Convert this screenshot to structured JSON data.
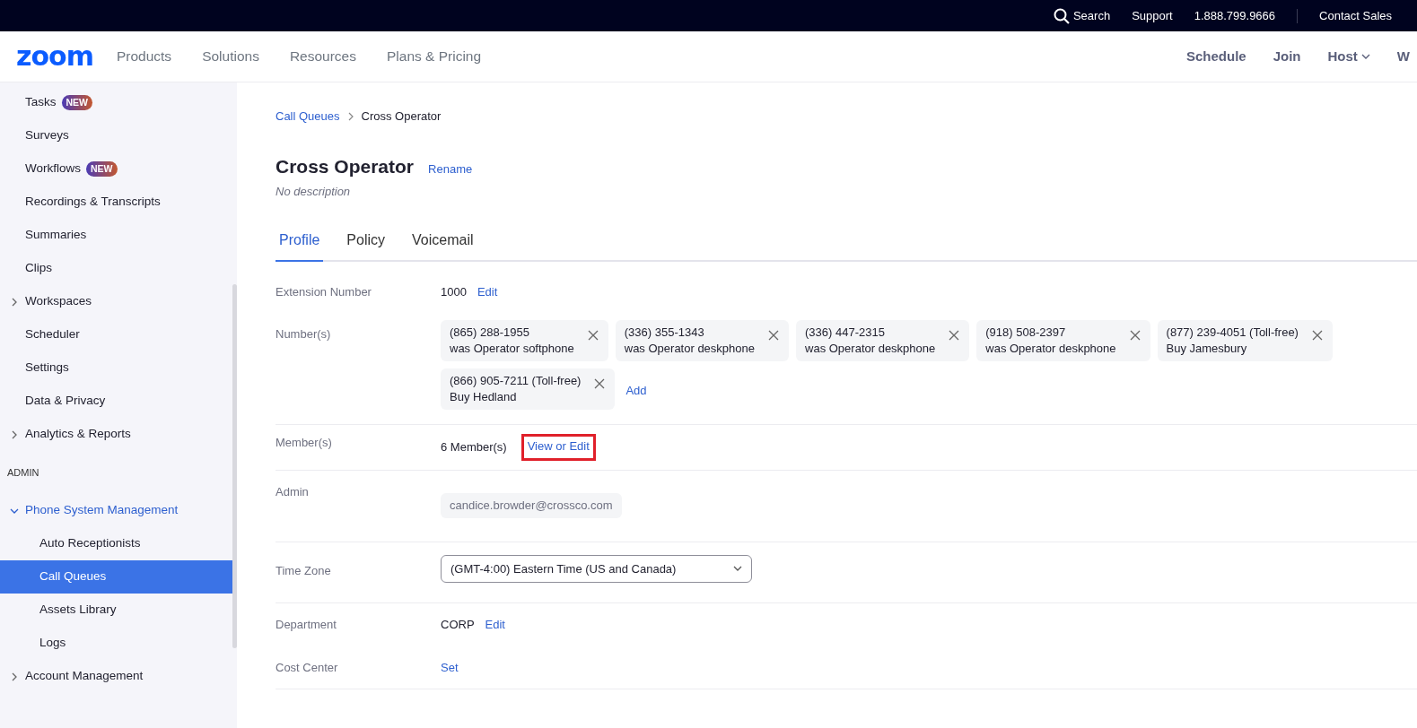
{
  "top_bar": {
    "search": "Search",
    "links": [
      "Support",
      "1.888.799.9666",
      "Contact Sales"
    ]
  },
  "nav": {
    "logo": "zoom",
    "menu": [
      "Products",
      "Solutions",
      "Resources",
      "Plans & Pricing"
    ],
    "actions": [
      {
        "label": "Schedule",
        "dropdown": false
      },
      {
        "label": "Join",
        "dropdown": false
      },
      {
        "label": "Host",
        "dropdown": true
      },
      {
        "label": "W",
        "dropdown": false
      }
    ]
  },
  "sidebar": {
    "items": [
      {
        "kind": "item",
        "label": "Tasks",
        "badge": "NEW"
      },
      {
        "kind": "item",
        "label": "Surveys"
      },
      {
        "kind": "item",
        "label": "Workflows",
        "badge": "NEW"
      },
      {
        "kind": "item",
        "label": "Recordings & Transcripts"
      },
      {
        "kind": "item",
        "label": "Summaries"
      },
      {
        "kind": "item",
        "label": "Clips"
      },
      {
        "kind": "item",
        "label": "Workspaces",
        "expanded": false
      },
      {
        "kind": "item",
        "label": "Scheduler"
      },
      {
        "kind": "item",
        "label": "Settings"
      },
      {
        "kind": "item",
        "label": "Data & Privacy"
      },
      {
        "kind": "item",
        "label": "Analytics & Reports",
        "expanded": false
      },
      {
        "kind": "section",
        "label": "ADMIN"
      },
      {
        "kind": "item",
        "label": "Phone System Management",
        "expanded": true,
        "children": [
          {
            "label": "Auto Receptionists",
            "selected": false
          },
          {
            "label": "Call Queues",
            "selected": true
          },
          {
            "label": "Assets Library",
            "selected": false
          },
          {
            "label": "Logs",
            "selected": false
          }
        ]
      },
      {
        "kind": "item",
        "label": "Account Management",
        "expanded": false
      }
    ]
  },
  "breadcrumb": [
    "Call Queues",
    "Cross Operator"
  ],
  "title": "Cross Operator",
  "rename": "Rename",
  "description": "No description",
  "tabs": [
    {
      "label": "Profile",
      "selected": true
    },
    {
      "label": "Policy",
      "selected": false
    },
    {
      "label": "Voicemail",
      "selected": false
    }
  ],
  "fields": [
    {
      "kind": "text",
      "label": "Extension Number",
      "value": "1000",
      "action": "Edit",
      "divider": false
    },
    {
      "kind": "chips",
      "label": "Number(s)",
      "chips": [
        {
          "number": "(865) 288-1955",
          "note": "was Operator softphone"
        },
        {
          "number": "(336) 355-1343",
          "note": "was Operator deskphone"
        },
        {
          "number": "(336) 447-2315",
          "note": "was Operator deskphone"
        },
        {
          "number": "(918) 508-2397",
          "note": "was Operator deskphone"
        },
        {
          "number": "(877) 239-4051 (Toll-free)",
          "note": "Buy Jamesbury"
        },
        {
          "number": "(866) 905-7211 (Toll-free)",
          "note": "Buy Hedland"
        }
      ],
      "action": "Add",
      "divider": true
    },
    {
      "kind": "text",
      "label": "Member(s)",
      "value": "6 Member(s)",
      "action": "View or Edit",
      "highlighted": true,
      "divider": true
    },
    {
      "kind": "readonly",
      "label": "Admin",
      "value": "candice.browder@crossco.com",
      "divider": true
    },
    {
      "kind": "select",
      "label": "Time Zone",
      "value": "(GMT-4:00) Eastern Time (US and Canada)",
      "divider": true
    },
    {
      "kind": "text",
      "label": "Department",
      "value": "CORP",
      "action": "Edit",
      "divider": false
    },
    {
      "kind": "text",
      "label": "Cost Center",
      "action": "Set",
      "divider": true
    }
  ]
}
